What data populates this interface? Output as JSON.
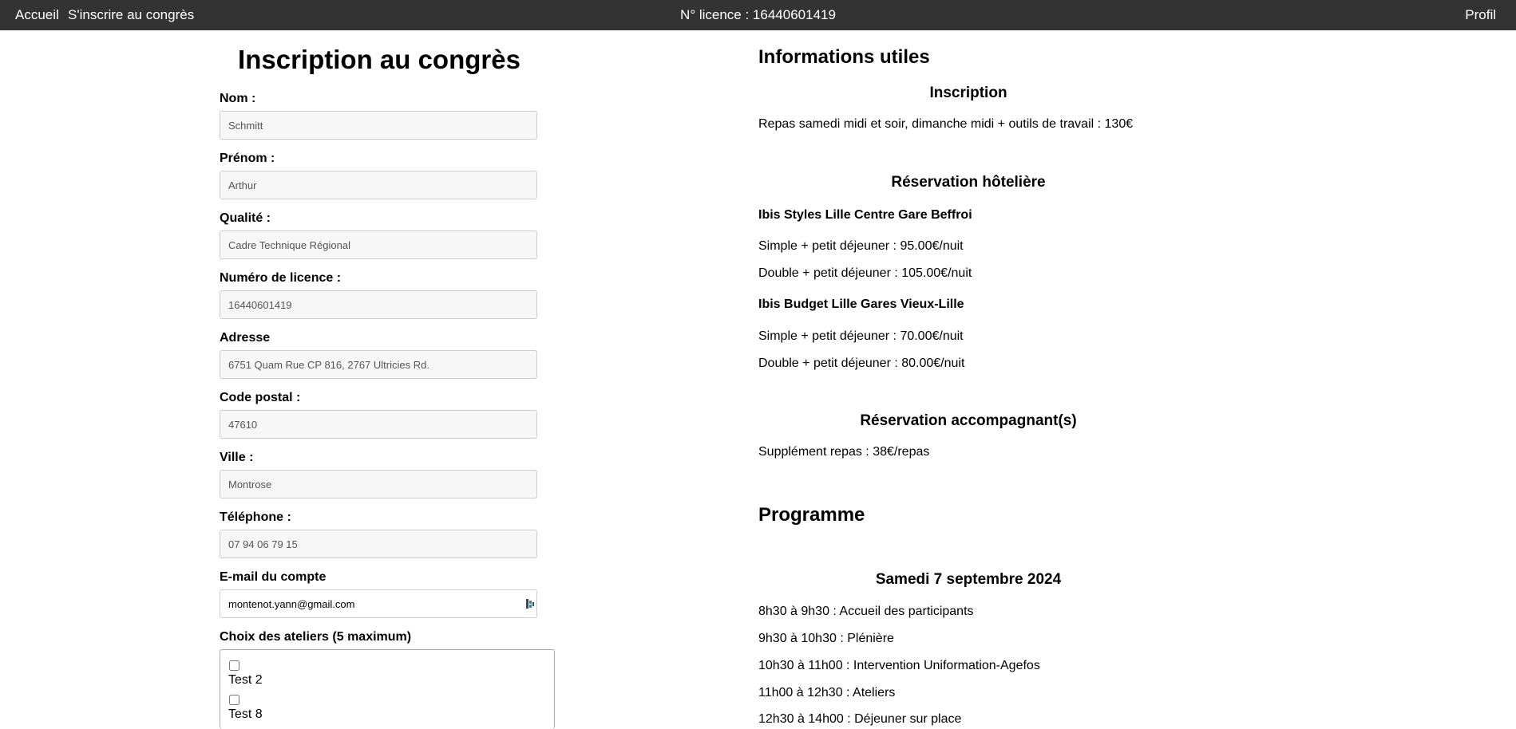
{
  "nav": {
    "home": "Accueil",
    "register": "S'inscrire au congrès",
    "license": "N° licence : 16440601419",
    "profile": "Profil"
  },
  "form": {
    "title": "Inscription au congrès",
    "fields": [
      {
        "label": "Nom :",
        "value": "Schmitt"
      },
      {
        "label": "Prénom :",
        "value": "Arthur"
      },
      {
        "label": "Qualité :",
        "value": "Cadre Technique Régional"
      },
      {
        "label": "Numéro de licence :",
        "value": "16440601419"
      },
      {
        "label": "Adresse",
        "value": "6751 Quam Rue CP 816, 2767 Ultricies Rd."
      },
      {
        "label": "Code postal :",
        "value": "47610"
      },
      {
        "label": "Ville :",
        "value": "Montrose"
      },
      {
        "label": "Téléphone :",
        "value": "07 94 06 79 15"
      },
      {
        "label": "E-mail du compte",
        "value": "montenot.yann@gmail.com"
      }
    ],
    "ateliers_label": "Choix des ateliers (5 maximum)",
    "ateliers": [
      "Test 2",
      "Test 8"
    ]
  },
  "info": {
    "title": "Informations utiles",
    "inscription": {
      "title": "Inscription",
      "text": "Repas samedi midi et soir, dimanche midi + outils de travail : 130€"
    },
    "hotel": {
      "title": "Réservation hôtelière",
      "hotels": [
        {
          "name": "Ibis Styles Lille Centre Gare Beffroi",
          "single": "Simple + petit déjeuner : 95.00€/nuit",
          "double": "Double + petit déjeuner : 105.00€/nuit"
        },
        {
          "name": "Ibis Budget Lille Gares Vieux-Lille",
          "single": "Simple + petit déjeuner : 70.00€/nuit",
          "double": "Double + petit déjeuner : 80.00€/nuit"
        }
      ]
    },
    "companion": {
      "title": "Réservation accompagnant(s)",
      "text": "Supplément repas : 38€/repas"
    }
  },
  "programme": {
    "title": "Programme",
    "day": "Samedi 7 septembre 2024",
    "items": [
      "8h30 à 9h30 : Accueil des participants",
      "9h30 à 10h30 : Plénière",
      "10h30 à 11h00 : Intervention Uniformation-Agefos",
      "11h00 à 12h30 : Ateliers",
      "12h30 à 14h00 : Déjeuner sur place"
    ]
  }
}
